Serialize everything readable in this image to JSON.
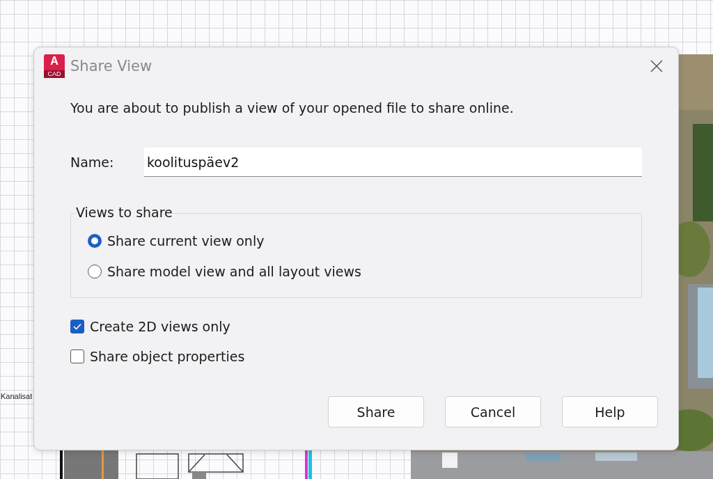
{
  "drawing": {
    "label": "Kanalisat"
  },
  "dialog": {
    "title": "Share View",
    "app_badge": "A",
    "app_badge_sub": "CAD",
    "message": "You are about to publish a view of your opened file to share online.",
    "name_label": "Name:",
    "name_value": "koolituspäev2",
    "group_title": "Views to share",
    "radios": [
      {
        "label": "Share current view only",
        "selected": true
      },
      {
        "label": "Share model view and all layout views",
        "selected": false
      }
    ],
    "checkboxes": [
      {
        "label": "Create 2D views only",
        "checked": true
      },
      {
        "label": "Share object properties",
        "checked": false
      }
    ],
    "buttons": [
      "Share",
      "Cancel",
      "Help"
    ]
  }
}
